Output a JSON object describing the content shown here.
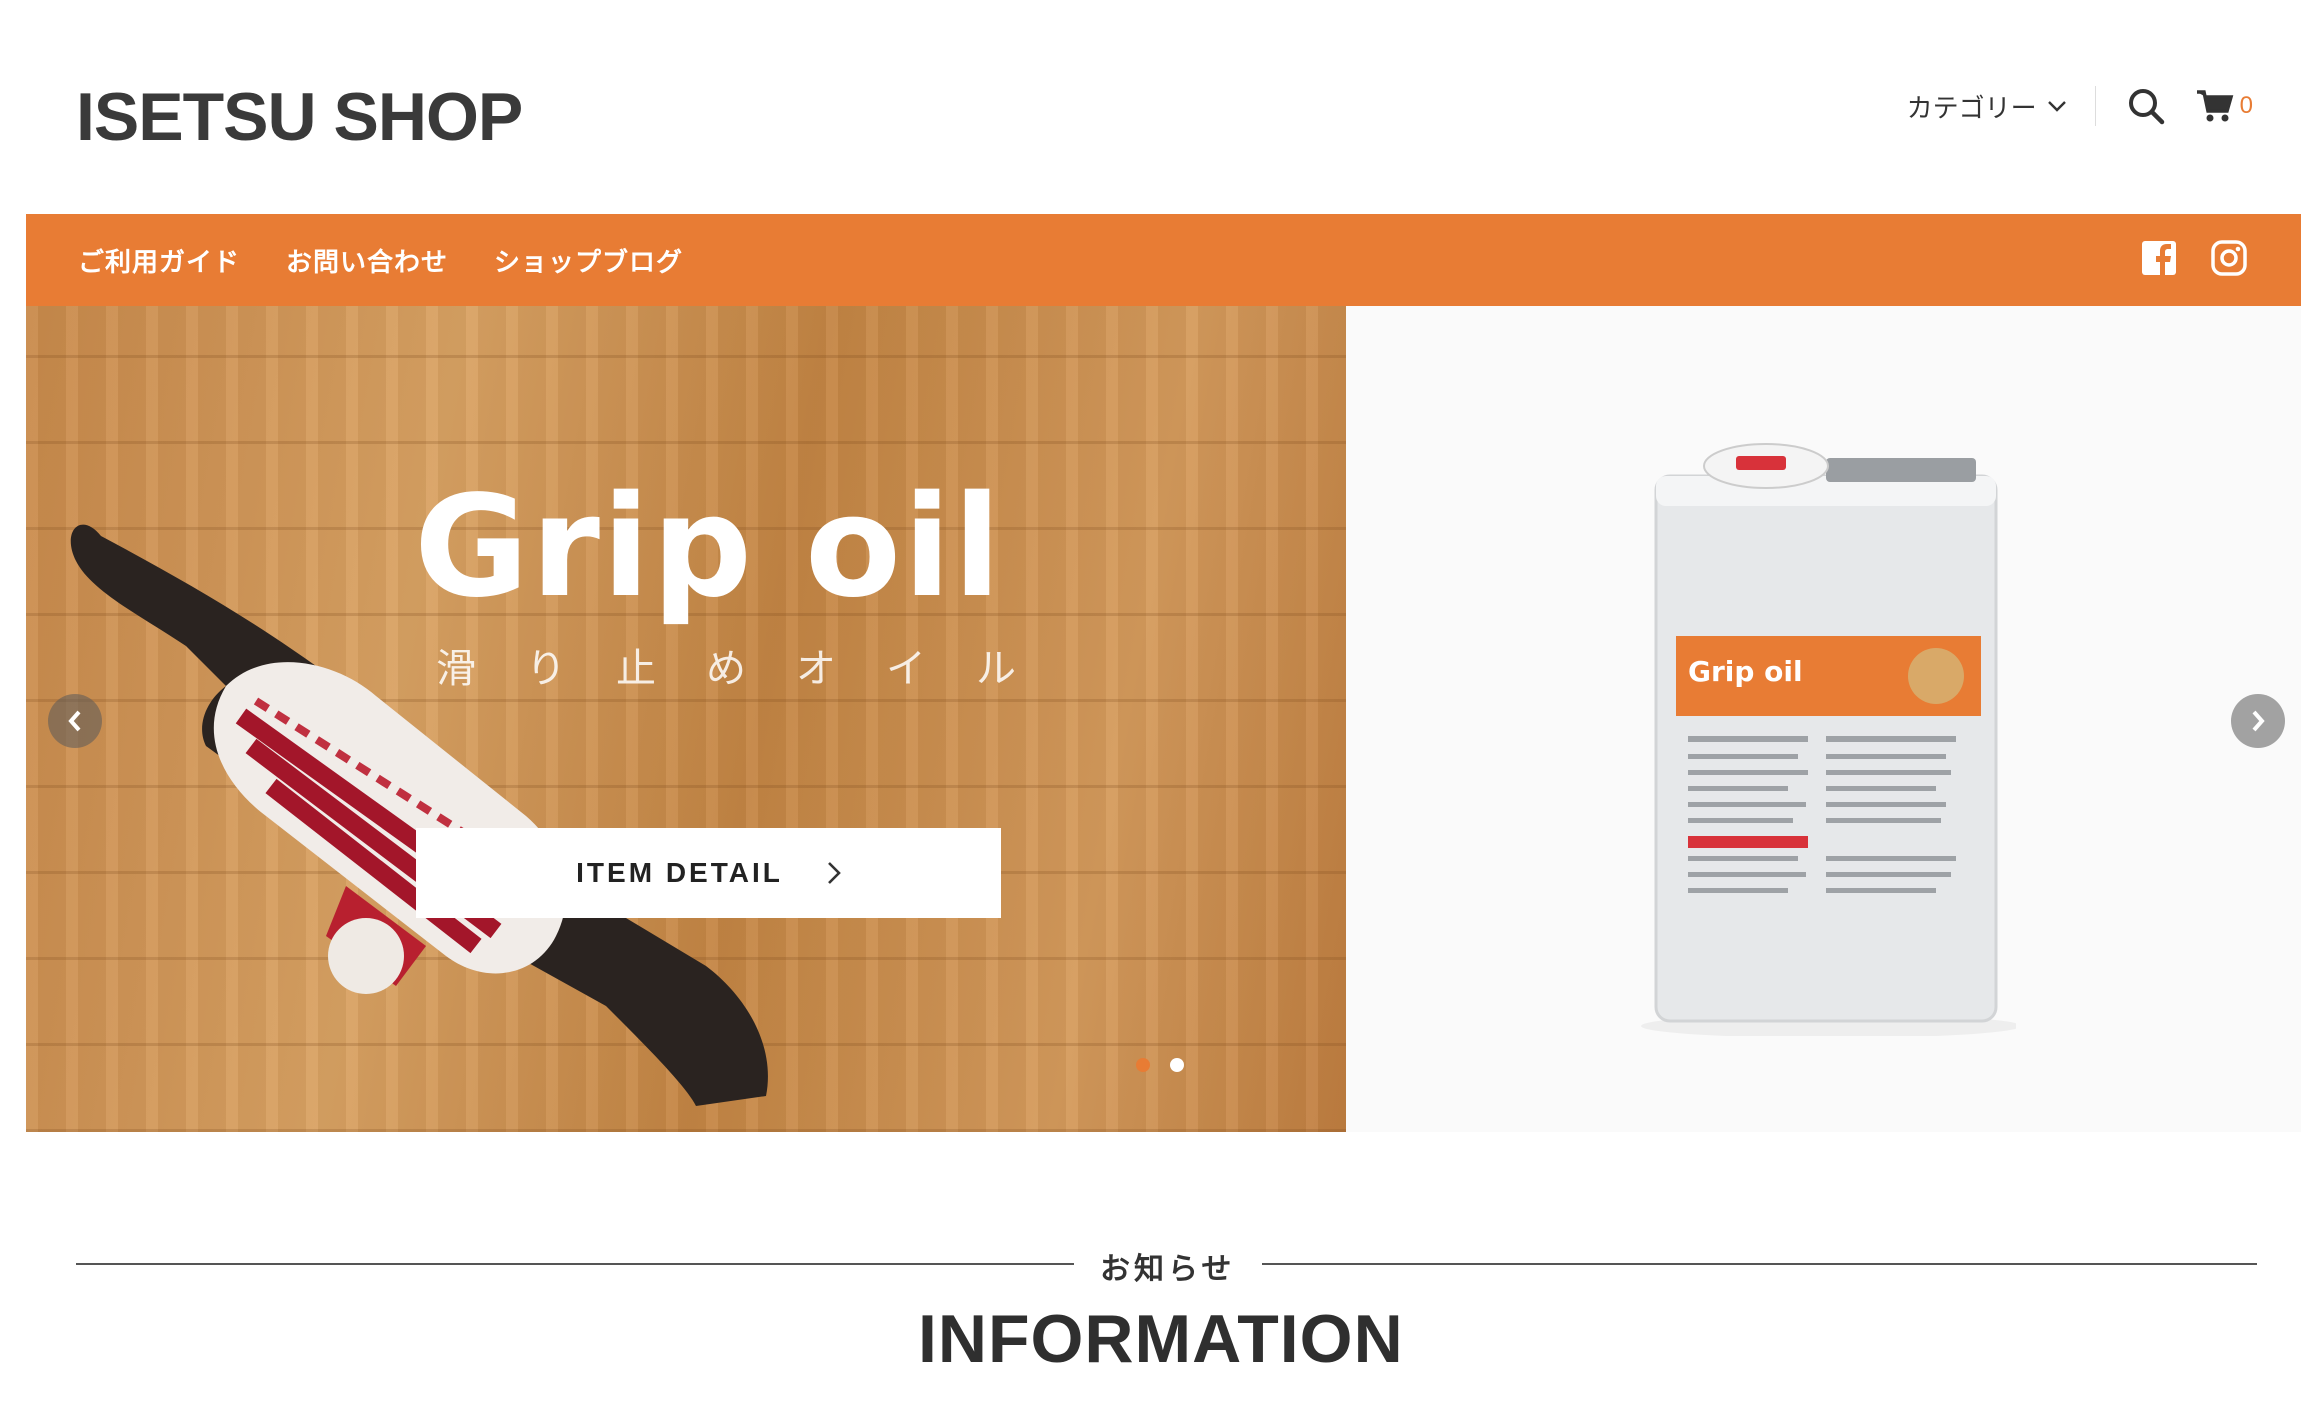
{
  "header": {
    "logo": "ISETSU SHOP",
    "category_label": "カテゴリー",
    "cart_count": "0"
  },
  "nav": {
    "links": [
      "ご利用ガイド",
      "お問い合わせ",
      "ショップブログ"
    ]
  },
  "hero": {
    "title": "Grip oil",
    "subtitle": "滑り止めオイル",
    "button_label": "ITEM DETAIL",
    "can_label": "Grip oil",
    "active_slide": 1,
    "slide_count": 2
  },
  "info": {
    "jp_title": "お知らせ",
    "en_title": "INFORMATION"
  },
  "colors": {
    "accent": "#e87c34",
    "dot_active": "#e87c34",
    "dot_inactive": "#ffffff"
  },
  "icons": [
    "chevron-down-icon",
    "search-icon",
    "cart-icon",
    "facebook-icon",
    "instagram-icon",
    "arrow-left-icon",
    "arrow-right-icon",
    "chevron-right-icon"
  ]
}
